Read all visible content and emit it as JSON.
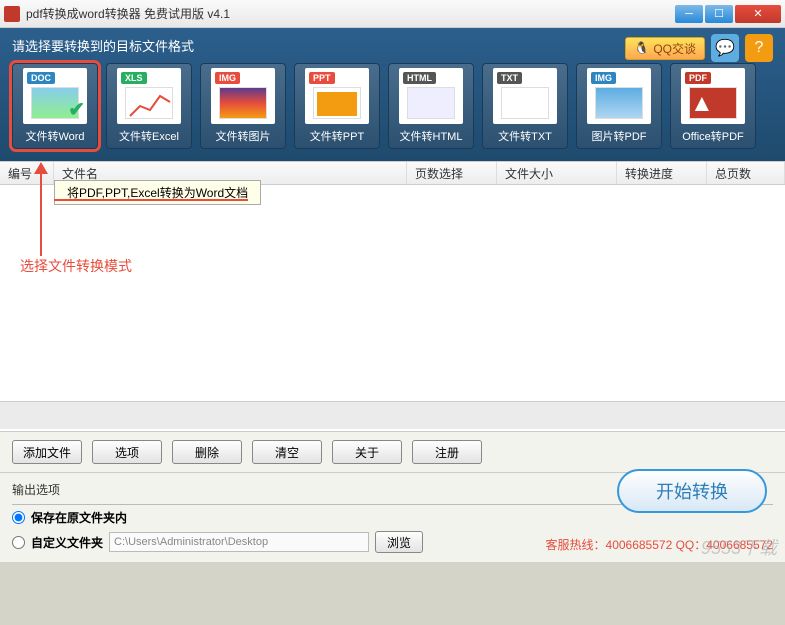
{
  "window": {
    "title": "pdf转换成word转换器 免费试用版 v4.1"
  },
  "header": {
    "prompt": "请选择要转换到的目标文件格式",
    "qq_label": "QQ交谈",
    "formats": [
      {
        "tag": "DOC",
        "tag_color": "#2e86c1",
        "label": "文件转Word",
        "preview_bg": "linear-gradient(#87ceeb,#90ee90)",
        "selected": true,
        "check": true
      },
      {
        "tag": "XLS",
        "tag_color": "#27ae60",
        "label": "文件转Excel",
        "preview_bg": "#fff",
        "chart": true
      },
      {
        "tag": "IMG",
        "tag_color": "#e74c3c",
        "label": "文件转图片",
        "preview_bg": "linear-gradient(#5d3a8e,#e74c3c,#f39c12)"
      },
      {
        "tag": "PPT",
        "tag_color": "#e74c3c",
        "label": "文件转PPT",
        "preview_bg": "#fff",
        "ppt": true
      },
      {
        "tag": "HTML",
        "tag_color": "#555",
        "label": "文件转HTML",
        "preview_bg": "#eef"
      },
      {
        "tag": "TXT",
        "tag_color": "#555",
        "label": "文件转TXT",
        "preview_bg": "#fff"
      },
      {
        "tag": "IMG",
        "tag_color": "#2e86c1",
        "label": "图片转PDF",
        "preview_bg": "linear-gradient(#5dade2,#aed6f1)"
      },
      {
        "tag": "PDF",
        "tag_color": "#c0392b",
        "label": "Office转PDF",
        "preview_bg": "#c0392b",
        "pdf": true
      }
    ]
  },
  "tooltip": "将PDF,PPT,Excel转换为Word文档",
  "annotation": "选择文件转换模式",
  "table": {
    "headers": [
      "编号",
      "文件名",
      "页数选择",
      "文件大小",
      "转换进度",
      "总页数"
    ]
  },
  "buttons": {
    "add": "添加文件",
    "options": "选项",
    "delete": "删除",
    "clear": "清空",
    "about": "关于",
    "register": "注册"
  },
  "output": {
    "title": "输出选项",
    "opt1": "保存在原文件夹内",
    "opt2": "自定义文件夹",
    "path": "C:\\Users\\Administrator\\Desktop",
    "browse": "浏览",
    "start": "开始转换",
    "hotline": "客服热线：4006685572 QQ：4006685572"
  },
  "watermark": "9553下载"
}
